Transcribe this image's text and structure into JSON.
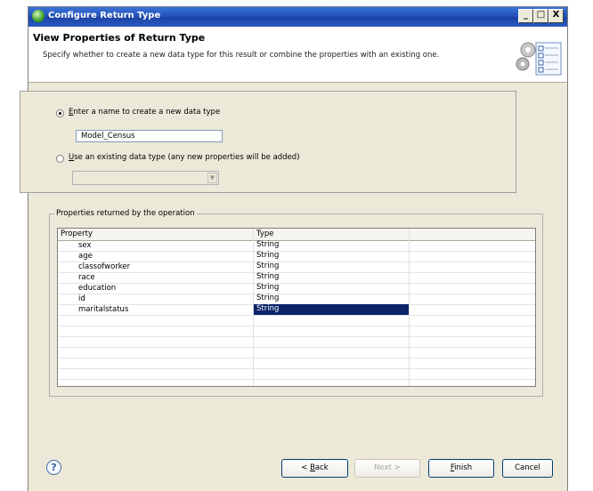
{
  "window": {
    "title": "Configure Return Type",
    "controls": {
      "minimize": "_",
      "maximize": "□",
      "close": "X"
    }
  },
  "header": {
    "title": "View Properties of Return Type",
    "description": "Specify whether to create a new data type for this result or combine the properties with an existing one.",
    "icon": "gears-checklist-icon"
  },
  "options": {
    "new_type": {
      "label_accel": "E",
      "label_rest": "nter a name to create a new data type",
      "selected": true,
      "value": "Model_Census"
    },
    "existing_type": {
      "label_accel": "U",
      "label_rest": "se an existing data type (any new properties will be added)",
      "selected": false,
      "value": ""
    }
  },
  "properties_group": {
    "legend": "Properties returned by the operation",
    "columns": [
      "Property",
      "Type"
    ],
    "rows": [
      {
        "property": "sex",
        "type": "String"
      },
      {
        "property": "age",
        "type": "String"
      },
      {
        "property": "classofworker",
        "type": "String"
      },
      {
        "property": "race",
        "type": "String"
      },
      {
        "property": "education",
        "type": "String"
      },
      {
        "property": "id",
        "type": "String"
      },
      {
        "property": "maritalstatus",
        "type": "String",
        "selected": true
      }
    ]
  },
  "footer": {
    "help": "?",
    "back_accel": "B",
    "back_rest": "ack",
    "back_prefix": "< ",
    "next": "Next >",
    "finish_accel": "F",
    "finish_rest": "inish",
    "cancel": "Cancel"
  },
  "colors": {
    "selection": "#0a246a",
    "titlebar": "#2452b8",
    "dialog_bg": "#ece9d8"
  }
}
